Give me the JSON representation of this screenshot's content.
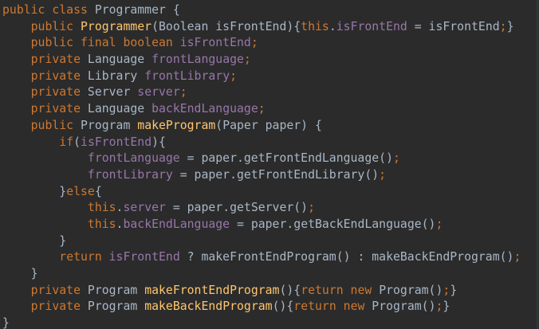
{
  "colors": {
    "background": "#2b2b2b",
    "keyword": "#cc7832",
    "function": "#ffc66d",
    "field": "#9876aa",
    "type": "#a9b7c6",
    "plain": "#a9b7c6",
    "semicolon": "#cc7832"
  },
  "lines": [
    [
      [
        "kw",
        "public class "
      ],
      [
        "ty",
        "Programmer "
      ],
      [
        "pl",
        "{"
      ]
    ],
    [
      [
        "pl",
        "    "
      ],
      [
        "kw",
        "public "
      ],
      [
        "fn",
        "Programmer"
      ],
      [
        "pl",
        "(Boolean isFrontEnd){"
      ],
      [
        "kw",
        "this"
      ],
      [
        "pl",
        "."
      ],
      [
        "fld",
        "isFrontEnd"
      ],
      [
        "pl",
        " = isFrontEnd"
      ],
      [
        "sc",
        ";"
      ],
      [
        "pl",
        "}"
      ]
    ],
    [
      [
        "pl",
        "    "
      ],
      [
        "kw",
        "public final boolean "
      ],
      [
        "fld",
        "isFrontEnd"
      ],
      [
        "sc",
        ";"
      ]
    ],
    [
      [
        "pl",
        "    "
      ],
      [
        "kw",
        "private "
      ],
      [
        "ty",
        "Language "
      ],
      [
        "fld",
        "frontLanguage"
      ],
      [
        "sc",
        ";"
      ]
    ],
    [
      [
        "pl",
        "    "
      ],
      [
        "kw",
        "private "
      ],
      [
        "ty",
        "Library "
      ],
      [
        "fld",
        "frontLibrary"
      ],
      [
        "sc",
        ";"
      ]
    ],
    [
      [
        "pl",
        "    "
      ],
      [
        "kw",
        "private "
      ],
      [
        "ty",
        "Server "
      ],
      [
        "fld",
        "server"
      ],
      [
        "sc",
        ";"
      ]
    ],
    [
      [
        "pl",
        "    "
      ],
      [
        "kw",
        "private "
      ],
      [
        "ty",
        "Language "
      ],
      [
        "fld",
        "backEndLanguage"
      ],
      [
        "sc",
        ";"
      ]
    ],
    [
      [
        "pl",
        "    "
      ],
      [
        "kw",
        "public "
      ],
      [
        "ty",
        "Program "
      ],
      [
        "fn",
        "makeProgram"
      ],
      [
        "pl",
        "(Paper paper) {"
      ]
    ],
    [
      [
        "pl",
        "        "
      ],
      [
        "kw",
        "if"
      ],
      [
        "pl",
        "("
      ],
      [
        "fld",
        "isFrontEnd"
      ],
      [
        "pl",
        "){"
      ]
    ],
    [
      [
        "pl",
        "            "
      ],
      [
        "fld",
        "frontLanguage"
      ],
      [
        "pl",
        " = paper.getFrontEndLanguage()"
      ],
      [
        "sc",
        ";"
      ]
    ],
    [
      [
        "pl",
        "            "
      ],
      [
        "fld",
        "frontLibrary"
      ],
      [
        "pl",
        " = paper.getFrontEndLibrary()"
      ],
      [
        "sc",
        ";"
      ]
    ],
    [
      [
        "pl",
        "        }"
      ],
      [
        "kw",
        "else"
      ],
      [
        "pl",
        "{"
      ]
    ],
    [
      [
        "pl",
        "            "
      ],
      [
        "kw",
        "this"
      ],
      [
        "pl",
        "."
      ],
      [
        "fld",
        "server"
      ],
      [
        "pl",
        " = paper.getServer()"
      ],
      [
        "sc",
        ";"
      ]
    ],
    [
      [
        "pl",
        "            "
      ],
      [
        "kw",
        "this"
      ],
      [
        "pl",
        "."
      ],
      [
        "fld",
        "backEndLanguage"
      ],
      [
        "pl",
        " = paper.getBackEndLanguage()"
      ],
      [
        "sc",
        ";"
      ]
    ],
    [
      [
        "pl",
        "        }"
      ]
    ],
    [
      [
        "pl",
        "        "
      ],
      [
        "kw",
        "return "
      ],
      [
        "fld",
        "isFrontEnd"
      ],
      [
        "pl",
        " ? makeFrontEndProgram() : makeBackEndProgram()"
      ],
      [
        "sc",
        ";"
      ]
    ],
    [
      [
        "pl",
        "    }"
      ]
    ],
    [
      [
        "pl",
        "    "
      ],
      [
        "kw",
        "private "
      ],
      [
        "ty",
        "Program "
      ],
      [
        "fn",
        "makeFrontEndProgram"
      ],
      [
        "pl",
        "(){"
      ],
      [
        "kw",
        "return new "
      ],
      [
        "pl",
        "Program()"
      ],
      [
        "sc",
        ";"
      ],
      [
        "pl",
        "}"
      ]
    ],
    [
      [
        "pl",
        "    "
      ],
      [
        "kw",
        "private "
      ],
      [
        "ty",
        "Program "
      ],
      [
        "fn",
        "makeBackEndProgram"
      ],
      [
        "pl",
        "(){"
      ],
      [
        "kw",
        "return new "
      ],
      [
        "pl",
        "Program()"
      ],
      [
        "sc",
        ";"
      ],
      [
        "pl",
        "}"
      ]
    ],
    [
      [
        "pl",
        "}"
      ]
    ]
  ]
}
